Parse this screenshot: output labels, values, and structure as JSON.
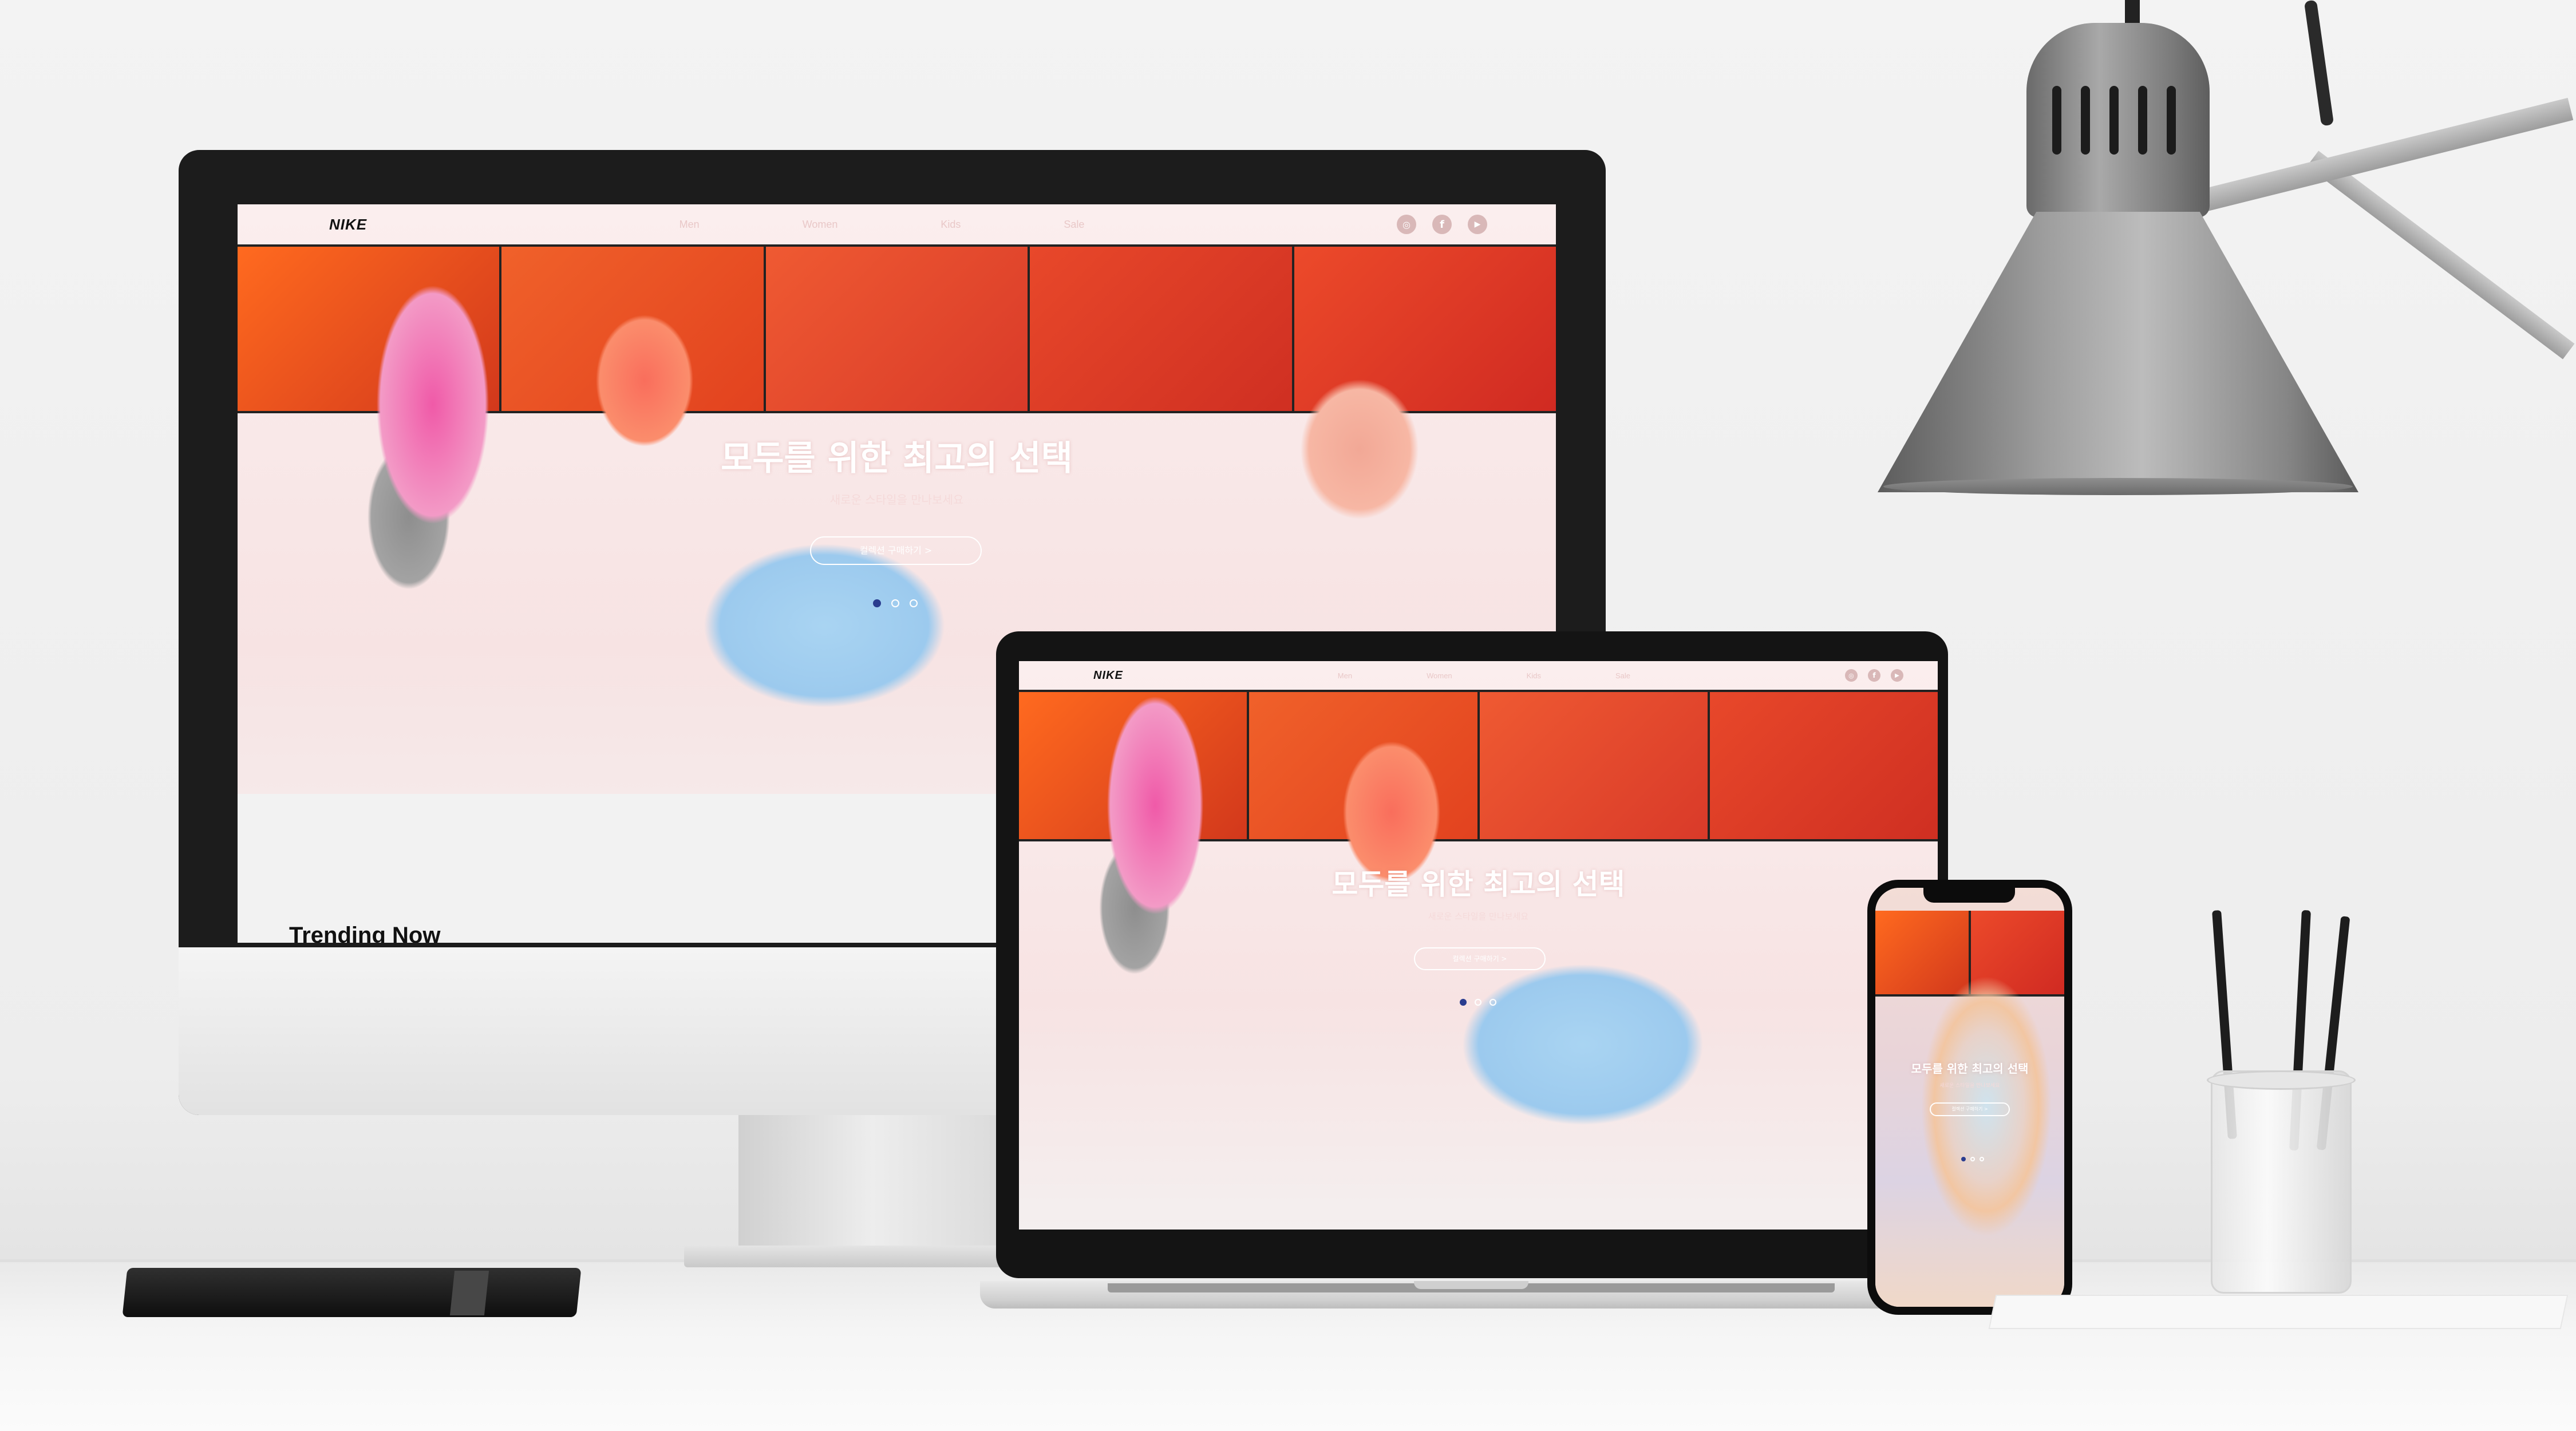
{
  "site": {
    "logo": "NIKE",
    "nav": [
      "Men",
      "Women",
      "Kids",
      "Sale"
    ],
    "hero_title": "모두를 위한 최고의 선택",
    "hero_subtitle": "새로운 스타일을 만나보세요",
    "hero_cta": "컬렉션 구매하기 >",
    "section_heading": "Trending Now",
    "banner_colors": [
      "#e0431e",
      "#ea5228",
      "#e6482e",
      "#df3a25",
      "#e33024"
    ]
  },
  "icons": [
    "instagram-icon",
    "facebook-icon",
    "youtube-icon"
  ],
  "colors": {
    "accent_red": "#e24125",
    "hero_bg": "#fbeeee",
    "dot_active": "#2a3d8f"
  },
  "carousel": {
    "dots": 3,
    "active": 1
  }
}
